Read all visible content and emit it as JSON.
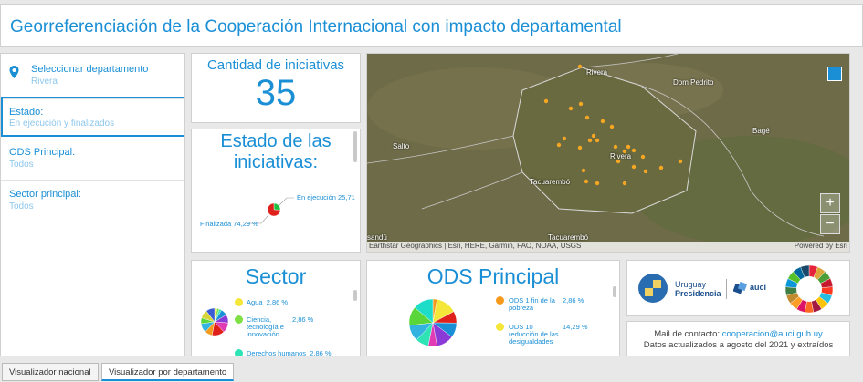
{
  "header": {
    "title": "Georreferenciación de la Cooperación Internacional con impacto departamental"
  },
  "filters": [
    {
      "label": "Seleccionar departamento",
      "value": "Rivera"
    },
    {
      "label": "Estado:",
      "value": "En ejecución y finalizados"
    },
    {
      "label": "ODS Principal:",
      "value": "Todos"
    },
    {
      "label": "Sector principal:",
      "value": "Todos"
    }
  ],
  "kpi": {
    "title": "Cantidad de iniciativas",
    "value": "35"
  },
  "estado": {
    "title_line1": "Estado de las",
    "title_line2": "iniciativas:",
    "label_a": "En ejecución 25,71",
    "label_b": "Finalizada 74,29 %"
  },
  "chart_data": [
    {
      "type": "pie",
      "title": "Estado de las iniciativas:",
      "categories": [
        "En ejecución",
        "Finalizada"
      ],
      "values": [
        25.71,
        74.29
      ],
      "colors": [
        "#1dbf3c",
        "#e0201b"
      ]
    },
    {
      "type": "pie",
      "title": "Sector",
      "categories": [
        "Agua",
        "Ciencia, tecnología e innovación",
        "Derechos humanos"
      ],
      "values": [
        2.86,
        2.86,
        2.86
      ],
      "colors": [
        "#f5e63a",
        "#7ee043",
        "#2ee3b4"
      ]
    },
    {
      "type": "pie",
      "title": "ODS Principal",
      "categories": [
        "ODS 1 fin de la pobreza",
        "ODS 10 reducción de las desigualdades"
      ],
      "values": [
        2.86,
        14.29
      ],
      "colors": [
        "#f59a1d",
        "#f5e63a"
      ]
    }
  ],
  "map": {
    "labels": [
      "Rivera",
      "Dom Pedrito",
      "Bagé",
      "Salto",
      "Rivera",
      "Tacuarembó",
      "Tacuarembó",
      "sandú"
    ],
    "attribution": "Earthstar Geographics | Esri, HERE, Garmin, FAO, NOAA, USGS",
    "powered": "Powered by Esri",
    "zoom_in": "+",
    "zoom_out": "−",
    "marker_color": "#f5a623"
  },
  "sector": {
    "title": "Sector",
    "items": [
      {
        "name": "Agua",
        "value": "2,86 %"
      },
      {
        "name": "Ciencia, tecnología e innovación",
        "value": "2,86 %"
      },
      {
        "name": "Derechos humanos",
        "value": "2,86 %"
      }
    ]
  },
  "ods": {
    "title": "ODS Principal",
    "items": [
      {
        "name": "ODS 1 fin de la pobreza",
        "value": "2,86 %"
      },
      {
        "name": "ODS 10 reducción de las desigualdades",
        "value": "14,29 %"
      }
    ]
  },
  "logos": {
    "uruguay_line1": "Uruguay",
    "uruguay_line2": "Presidencia",
    "auci": "auci"
  },
  "contact": {
    "prefix": "Mail de contacto: ",
    "email": "cooperacion@auci.gub.uy",
    "line2": "Datos actualizados a agosto del 2021 y extraídos"
  },
  "tabs": [
    "Visualizador nacional",
    "Visualizador por departamento"
  ]
}
